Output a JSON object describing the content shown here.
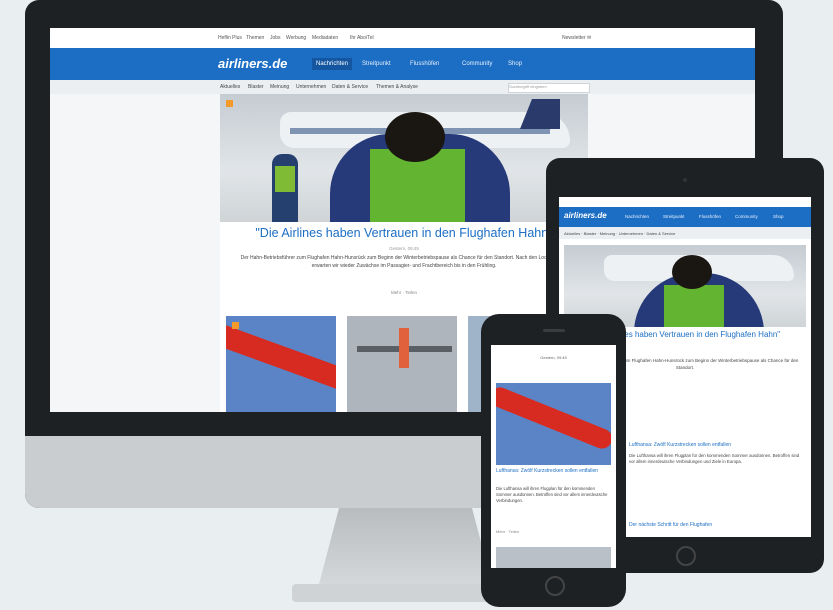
{
  "desktop": {
    "topbar": {
      "links": [
        "Heflin Plus",
        "Themen",
        "Jobs",
        "Werbung",
        "Mediadaten",
        "Ihr Abo/Tel"
      ],
      "right": "Newsletter ✉"
    },
    "logo": "airliners.de",
    "nav": [
      "Nachrichten",
      "Streitpunkt",
      "Flusshöfen",
      "Community",
      "Shop"
    ],
    "subnav": [
      "Aktuelles",
      "Blaster",
      "Meinung",
      "Unternehmen",
      "Daten & Service",
      "Themen & Analyse"
    ],
    "search_placeholder": "Suchbegriff eingeben",
    "headline": "\"Die Airlines haben Vertrauen in den Flughafen Hahn\"",
    "date": "Gestern, 09:45",
    "teaser": "Der Hahn-Betriebsführer zum Flughafen Hahn-Hunsrück zum Beginn der Winterbetriebspause als Chance für den Standort. Nach den Lockerungen erwarten wir wieder Zuwächse im Passagier- und Frachtbereich bis in den Frühling.",
    "meta": "Mehr · Teilen"
  },
  "tablet": {
    "logo": "airliners.de",
    "nav": [
      "Nachrichten",
      "Streitpunkt",
      "Flusshöfen",
      "Community",
      "Shop"
    ],
    "subnav": "Aktuelles · Blaster · Meinung · Unternehmen · Daten & Service",
    "headline": "\"Die Airlines haben Vertrauen in den Flughafen Hahn\"",
    "teaser": "Der Hahn-Betriebsführer zum Flughafen Hahn-Hunsrück zum Beginn der Winterbetriebspause als Chance für den Standort.",
    "article_title": "Lufthansa: Zwölf Kurzstrecken sollen entfallen",
    "article_text": "Die Lufthansa will ihren Flugplan für den kommenden Sommer ausdünnen. Betroffen sind vor allem innerdeutsche Verbindungen und Ziele in Europa.",
    "article2": "Der nächste Schritt für den Flughafen"
  },
  "phone": {
    "top": "Gestern, 09:45",
    "title": "Lufthansa: Zwölf Kurzstrecken sollen entfallen",
    "text": "Die Lufthansa will ihren Flugplan für den kommenden Sommer ausdünnen. Betroffen sind vor allem innerdeutsche Verbindungen.",
    "meta": "Mehr · Teilen"
  }
}
